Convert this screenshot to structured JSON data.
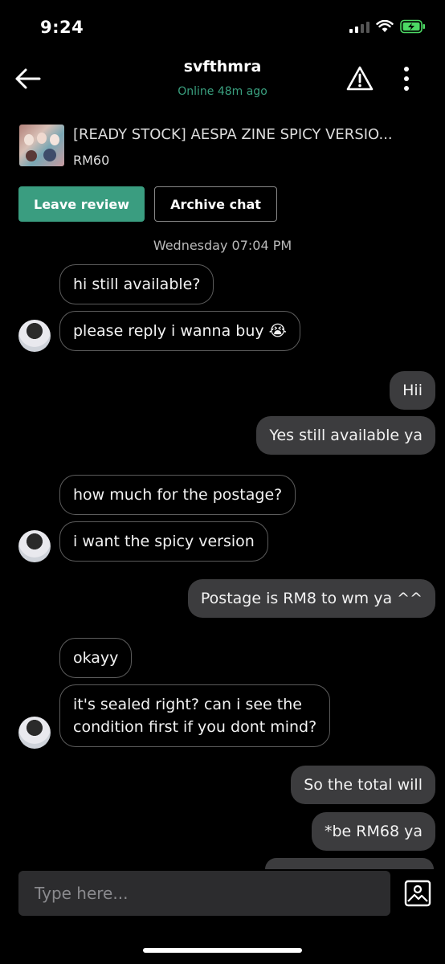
{
  "status_bar": {
    "time": "9:24"
  },
  "header": {
    "username": "svfthmra",
    "online_status": "Online 48m ago",
    "icons": [
      "back-arrow-icon",
      "warning-icon",
      "more-vertical-icon"
    ]
  },
  "product": {
    "title": "[READY STOCK] AESPA ZINE SPICY VERSIO...",
    "price": "RM60"
  },
  "actions": {
    "leave_review": "Leave review",
    "archive_chat": "Archive chat"
  },
  "date_divider": "Wednesday 07:04 PM",
  "messages": [
    {
      "from": "them",
      "text": "hi still available?"
    },
    {
      "from": "them",
      "text": "please reply i wanna buy 😭"
    },
    {
      "from": "me",
      "text": "Hii"
    },
    {
      "from": "me",
      "text": "Yes still available ya"
    },
    {
      "from": "them",
      "text": "how much for the postage?"
    },
    {
      "from": "them",
      "text": "i want the spicy version"
    },
    {
      "from": "me",
      "text": "Postage is RM8 to wm ya ^^"
    },
    {
      "from": "them",
      "text": "okayy"
    },
    {
      "from": "them",
      "text_line1": "it's sealed right? can i see the",
      "text_line2": "condition first if you dont mind?"
    },
    {
      "from": "me",
      "text": "So the total will"
    },
    {
      "from": "me",
      "text": "*be RM68 ya"
    }
  ],
  "composer": {
    "placeholder": "Type here..."
  },
  "colors": {
    "accent": "#3a9d80",
    "online": "#3aa07f",
    "outgoing_bubble": "#3c3c3e",
    "battery": "#4cd964"
  }
}
